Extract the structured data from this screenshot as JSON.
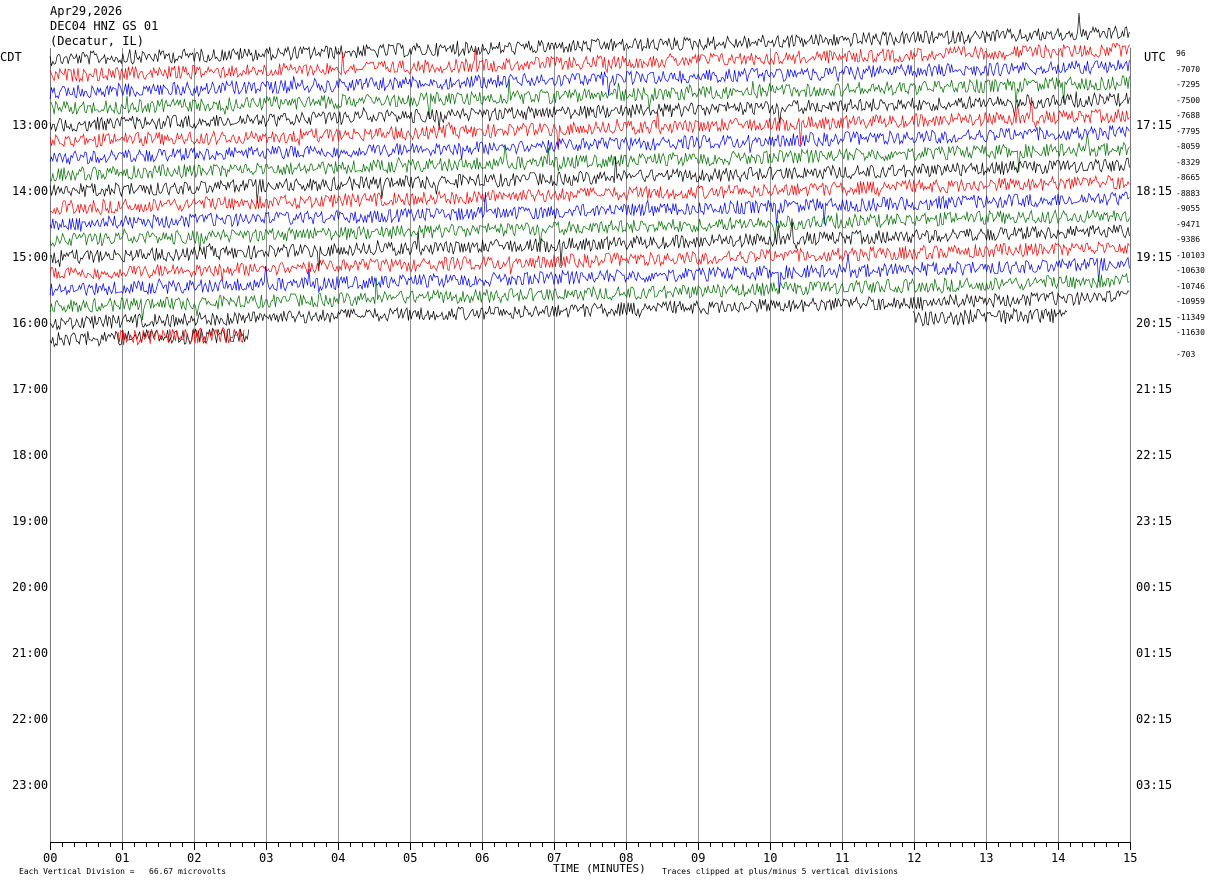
{
  "header": {
    "date": "Apr29,2026",
    "station": "DEC04 HNZ GS 01",
    "location": "(Decatur, IL)"
  },
  "left_zone": "CDT",
  "right_zone": "UTC",
  "chart_data": {
    "type": "line",
    "title": "",
    "xlabel": "TIME (MINUTES)",
    "ylabel": "",
    "xlim": [
      0,
      15
    ],
    "x_ticks": [
      "00",
      "01",
      "02",
      "03",
      "04",
      "05",
      "06",
      "07",
      "08",
      "09",
      "10",
      "11",
      "12",
      "13",
      "14",
      "15"
    ],
    "left_time_labels": [
      "13:00",
      "14:00",
      "15:00",
      "16:00",
      "17:00",
      "18:00",
      "19:00",
      "20:00",
      "21:00",
      "22:00",
      "23:00"
    ],
    "right_time_labels": [
      "17:15",
      "18:15",
      "19:15",
      "20:15",
      "21:15",
      "22:15",
      "23:15",
      "00:15",
      "01:15",
      "02:15",
      "03:15"
    ],
    "trace_colors": [
      "#000000",
      "#ff0000",
      "#0000ff",
      "#007000"
    ],
    "offset_values": [
      "96",
      "-7070",
      "-7295",
      "-7500",
      "-7688",
      "-7795",
      "-8059",
      "-8329",
      "-8665",
      "-8883",
      "-9055",
      "-9471",
      "-9386",
      "-10103",
      "-10630",
      "-10746",
      "-10959",
      "-11349",
      "-11630",
      "-703"
    ],
    "footer_scale": "Each Vertical Division =   66.67 microvolts",
    "footer_clip": "Traces clipped at plus/minus 5 vertical divisions",
    "grid": true
  }
}
